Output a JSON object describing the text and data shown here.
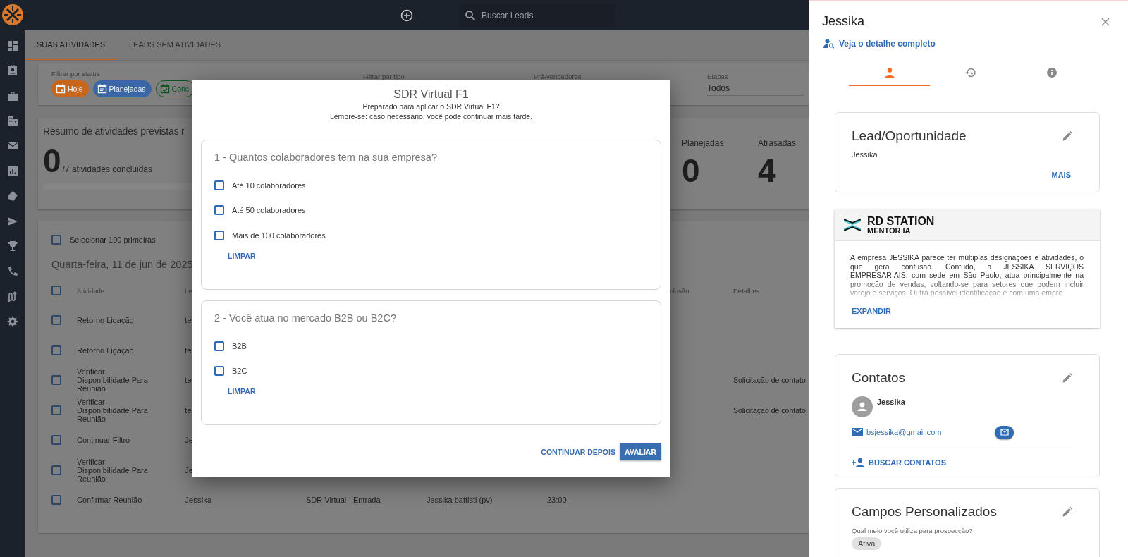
{
  "top_bar": {
    "search": {
      "placeholder": "Buscar Leads"
    }
  },
  "tabs": [
    {
      "label": "SUAS ATIVIDADES",
      "selected": true
    },
    {
      "label": "LEADS SEM ATIVIDADES",
      "selected": false
    }
  ],
  "filters": {
    "status_label": "Filtrar por status",
    "status_chips": [
      {
        "label": "Hoje",
        "kind": "today",
        "color": "#c8661c",
        "selected": true
      },
      {
        "label": "Planejadas",
        "kind": "planned",
        "color": "#3a66a6",
        "selected": true
      },
      {
        "label": "Conc",
        "kind": "done",
        "color": "#0e5520",
        "selected": false
      }
    ],
    "type_label": "Filtrar por tipo",
    "sellers_label": "Pré-vendedores",
    "stages": {
      "label": "Etapas",
      "value": "Todos"
    }
  },
  "summary": {
    "title": "Resumo de atividades previstas r",
    "done": "0",
    "total_text": "/7 atividades concluidas",
    "level": 0,
    "stats": [
      {
        "label": "Planejadas",
        "value": "0"
      },
      {
        "label": "Atrasadas",
        "value": "4"
      }
    ]
  },
  "activities": {
    "select_all": {
      "label": "Selecionar 100 primeiras",
      "checked": false
    },
    "date": "Quarta-feira, 11 de jun de 2025",
    "header_checked": false,
    "columns": [
      {
        "label": "Atividade"
      },
      {
        "label": "Le"
      },
      {
        "label": "clusão"
      },
      {
        "label": "Detalhes"
      }
    ],
    "rows": [
      {
        "checked": false,
        "activity": "Retorno Ligação",
        "lead": "te"
      },
      {
        "checked": false,
        "activity": "Retorno Ligação",
        "lead": "te"
      },
      {
        "checked": false,
        "activity": "Verificar Disponibilidade Para Reunião",
        "lead": "te",
        "details": "Solicitação de contato"
      },
      {
        "checked": false,
        "activity": "Verificar Disponibilidade Para Reunião",
        "lead": "te",
        "details": "Solicitação de contato"
      },
      {
        "checked": false,
        "activity": "Continuar Filtro",
        "lead": "Je"
      },
      {
        "checked": false,
        "activity": "Verificar Disponibilidade Para Reunião",
        "lead": "Je"
      },
      {
        "checked": false,
        "activity": "Confirmar Reunião",
        "lead": "Jessika",
        "column_3": "SDR Virtual - Entrada",
        "column_4": "Jessika battisti (pv)",
        "column_5": "23:00"
      }
    ]
  },
  "modal": {
    "title": "SDR Virtual F1",
    "subtitle_lines": [
      "Preparado para aplicar o SDR Virtual F1?",
      "Lembre-se: caso necessário, você pode continuar mais tarde."
    ],
    "questions": [
      {
        "text": "1 - Quantos colaboradores tem na sua empresa?",
        "options": [
          {
            "label": "Até 10 colaboradores",
            "checked": false
          },
          {
            "label": "Até 50 colaboradores",
            "checked": false
          },
          {
            "label": "Mais de 100 colaboradores",
            "checked": false
          }
        ],
        "clear_label": "LIMPAR"
      },
      {
        "text": "2 - Você atua no mercado B2B ou B2C?",
        "options": [
          {
            "label": "B2B",
            "checked": false
          },
          {
            "label": "B2C",
            "checked": false
          }
        ],
        "clear_label": "LIMPAR"
      }
    ],
    "buttons": [
      {
        "label": "CONTINUAR DEPOIS",
        "kind": "text"
      },
      {
        "label": "AVALIAR",
        "kind": "primary"
      }
    ]
  },
  "panel": {
    "title": "Jessika",
    "detail_link": "Veja o detalhe completo",
    "tabs": [
      {
        "kind": "person",
        "selected": true
      },
      {
        "kind": "history",
        "selected": false
      },
      {
        "kind": "info",
        "selected": false
      }
    ],
    "lead_card": {
      "title": "Lead/Oportunidade",
      "name": "Jessika",
      "more": "MAIS"
    },
    "mentor": {
      "brand": "RD STATION",
      "product": "MENTOR IA",
      "text": "A empresa JESSIKA parece ter múltiplas designações e atividades, o que gera confusão. Contudo, a JESSIKA SERVIÇOS EMPRESARIAIS, com sede em São Paulo, atua principalmente na promoção de vendas, voltando-se para setores que podem incluir varejo e serviços. Outra possível identificação é com uma empre",
      "expand": "EXPANDIR"
    },
    "contacts": {
      "title": "Contatos",
      "items": [
        {
          "name": "Jessika",
          "email": "bsjessika@gmail.com"
        }
      ],
      "search": "BUSCAR CONTATOS"
    },
    "custom_fields": {
      "title": "Campos Personalizados",
      "fields": [
        {
          "question": "Qual meio você utiliza para prospecção?",
          "value": "Ativa"
        }
      ]
    }
  }
}
